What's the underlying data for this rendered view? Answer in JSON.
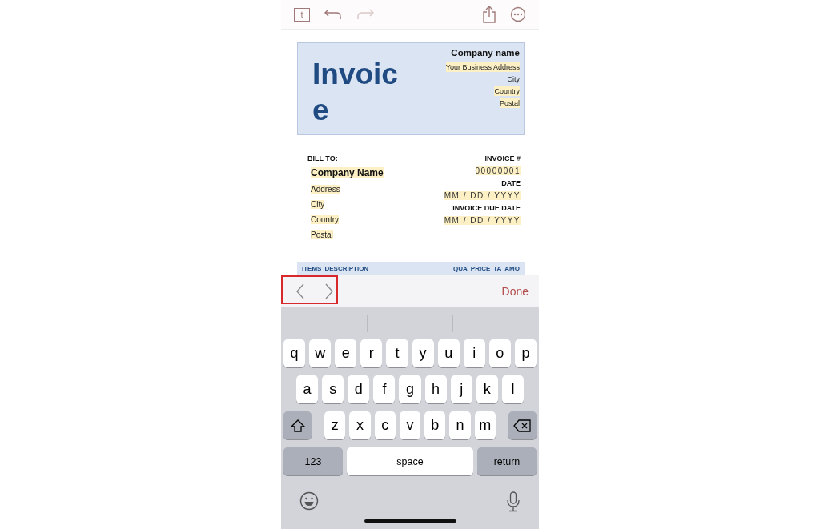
{
  "toolbar": {
    "document_badge": "t",
    "redo_disabled": true
  },
  "header": {
    "title": "Invoice",
    "company_name": "Company name",
    "address_lines": [
      {
        "text": "Your Business Address",
        "highlighted": true
      },
      {
        "text": "City",
        "highlighted": false
      },
      {
        "text": "Country",
        "highlighted": true
      },
      {
        "text": "Postal",
        "highlighted": true
      }
    ]
  },
  "bill_to": {
    "label": "BILL TO:",
    "lines": [
      {
        "text": "Company Name",
        "kind": "name"
      },
      {
        "text": "Address",
        "kind": "line"
      },
      {
        "text": "City",
        "kind": "line"
      },
      {
        "text": "Country",
        "kind": "line"
      },
      {
        "text": "Postal",
        "kind": "line"
      }
    ]
  },
  "invoice_info": [
    {
      "text": "INVOICE #",
      "kind": "label"
    },
    {
      "text": "00000001",
      "kind": "field"
    },
    {
      "text": "DATE",
      "kind": "label"
    },
    {
      "text": "MM / DD / YYYY",
      "kind": "field"
    },
    {
      "text": "INVOICE DUE DATE",
      "kind": "label"
    },
    {
      "text": "MM / DD / YYYY",
      "kind": "field"
    }
  ],
  "items_header": {
    "left": [
      "ITEMS",
      "DESCRIPTION"
    ],
    "right": [
      "QUA",
      "PRICE",
      "TA",
      "AMO"
    ]
  },
  "accessory_bar": {
    "nav_highlighted": true,
    "done": "Done"
  },
  "keyboard": {
    "rows": [
      [
        "q",
        "w",
        "e",
        "r",
        "t",
        "y",
        "u",
        "i",
        "o",
        "p"
      ],
      [
        "a",
        "s",
        "d",
        "f",
        "g",
        "h",
        "j",
        "k",
        "l"
      ],
      [
        "z",
        "x",
        "c",
        "v",
        "b",
        "n",
        "m"
      ]
    ],
    "numbers_key": "123",
    "space_key": "space",
    "return_key": "return"
  }
}
